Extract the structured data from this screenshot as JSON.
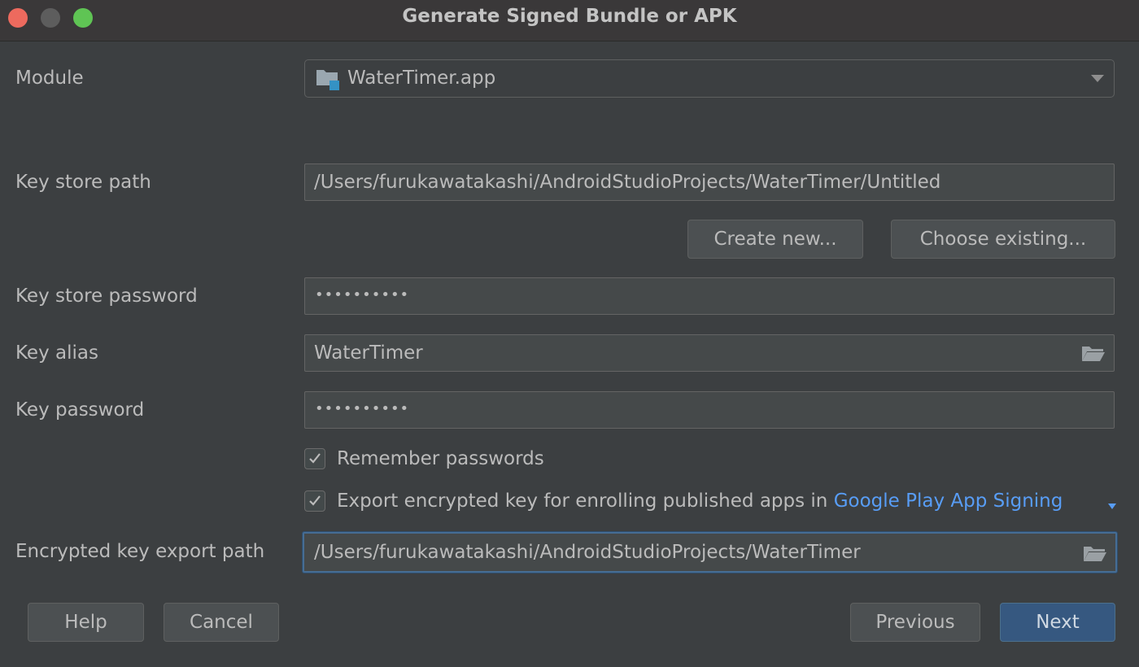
{
  "window": {
    "title": "Generate Signed Bundle or APK"
  },
  "form": {
    "module_label": "Module",
    "module_value": "WaterTimer.app",
    "key_store_path_label": "Key store path",
    "key_store_path_value": "/Users/furukawatakashi/AndroidStudioProjects/WaterTimer/Untitled",
    "create_new_label": "Create new...",
    "choose_existing_label": "Choose existing...",
    "key_store_password_label": "Key store password",
    "key_store_password_value": "••••••••••",
    "key_alias_label": "Key alias",
    "key_alias_value": "WaterTimer",
    "key_password_label": "Key password",
    "key_password_value": "••••••••••",
    "remember_passwords_label": "Remember passwords",
    "remember_passwords_checked": true,
    "export_key_label": "Export encrypted key for enrolling published apps in ",
    "export_key_link": "Google Play App Signing",
    "export_key_checked": true,
    "export_path_label": "Encrypted key export path",
    "export_path_value": "/Users/furukawatakashi/AndroidStudioProjects/WaterTimer"
  },
  "footer": {
    "help_label": "Help",
    "cancel_label": "Cancel",
    "previous_label": "Previous",
    "next_label": "Next"
  },
  "colors": {
    "background": "#3c3f41",
    "accent": "#365880",
    "link": "#589df6",
    "focus_border": "#466d94"
  }
}
